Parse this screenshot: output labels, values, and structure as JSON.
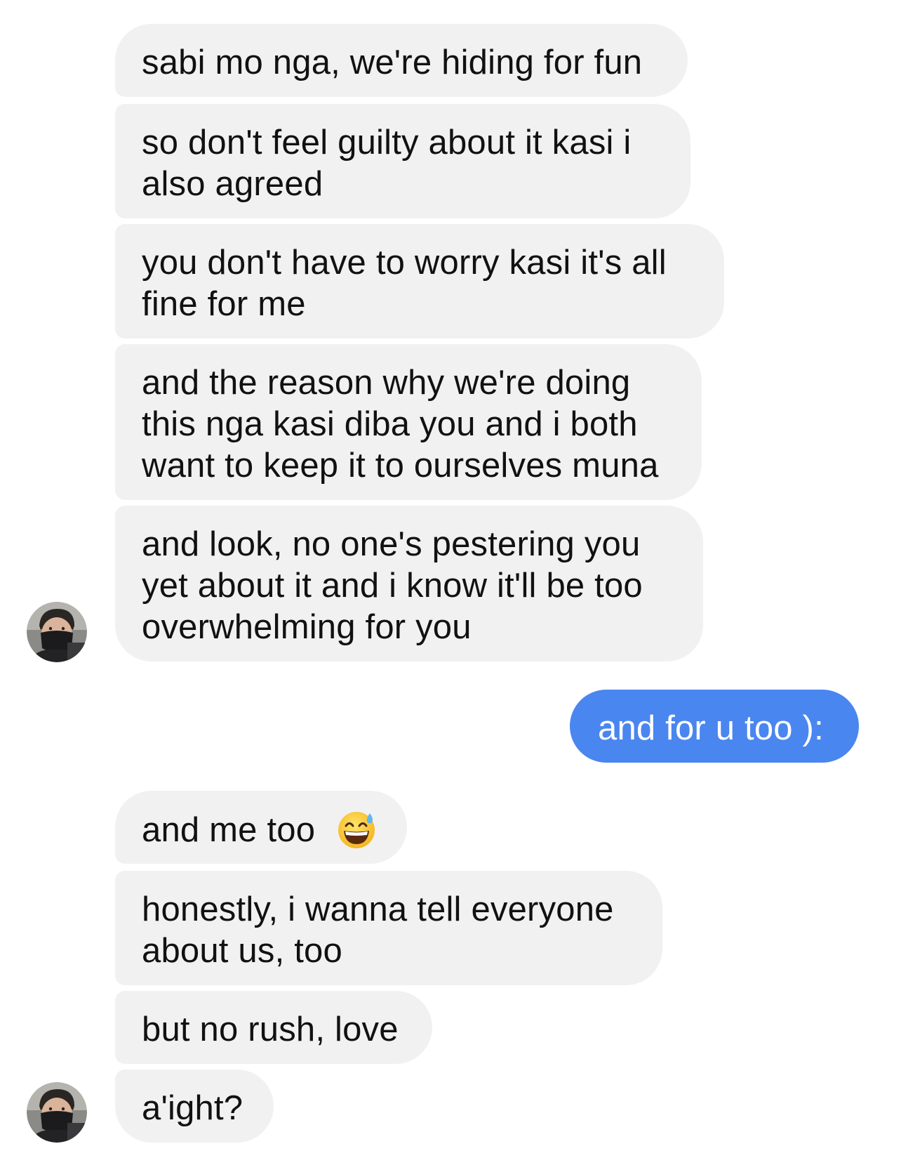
{
  "conversation": {
    "incoming_group_1": [
      "sabi mo nga, we're hiding for fun",
      "so don't feel guilty about it kasi i also agreed",
      "you don't have to worry kasi it's all fine for me",
      "and the reason why we're doing this nga kasi diba you and i both want to keep it to ourselves muna",
      "and look, no one's pestering you yet about it and i know it'll be too overwhelming for you"
    ],
    "outgoing_1": "and for u too ):",
    "incoming_group_2": [
      "and me too",
      "honestly, i wanna tell everyone about us, too",
      "but no rush, love",
      "a'ight?"
    ],
    "emoji_after_message": "grinning-face-with-sweat-icon"
  },
  "colors": {
    "incoming_bubble": "#f1f1f2",
    "outgoing_bubble": "#4a86ef",
    "text": "#111111"
  }
}
